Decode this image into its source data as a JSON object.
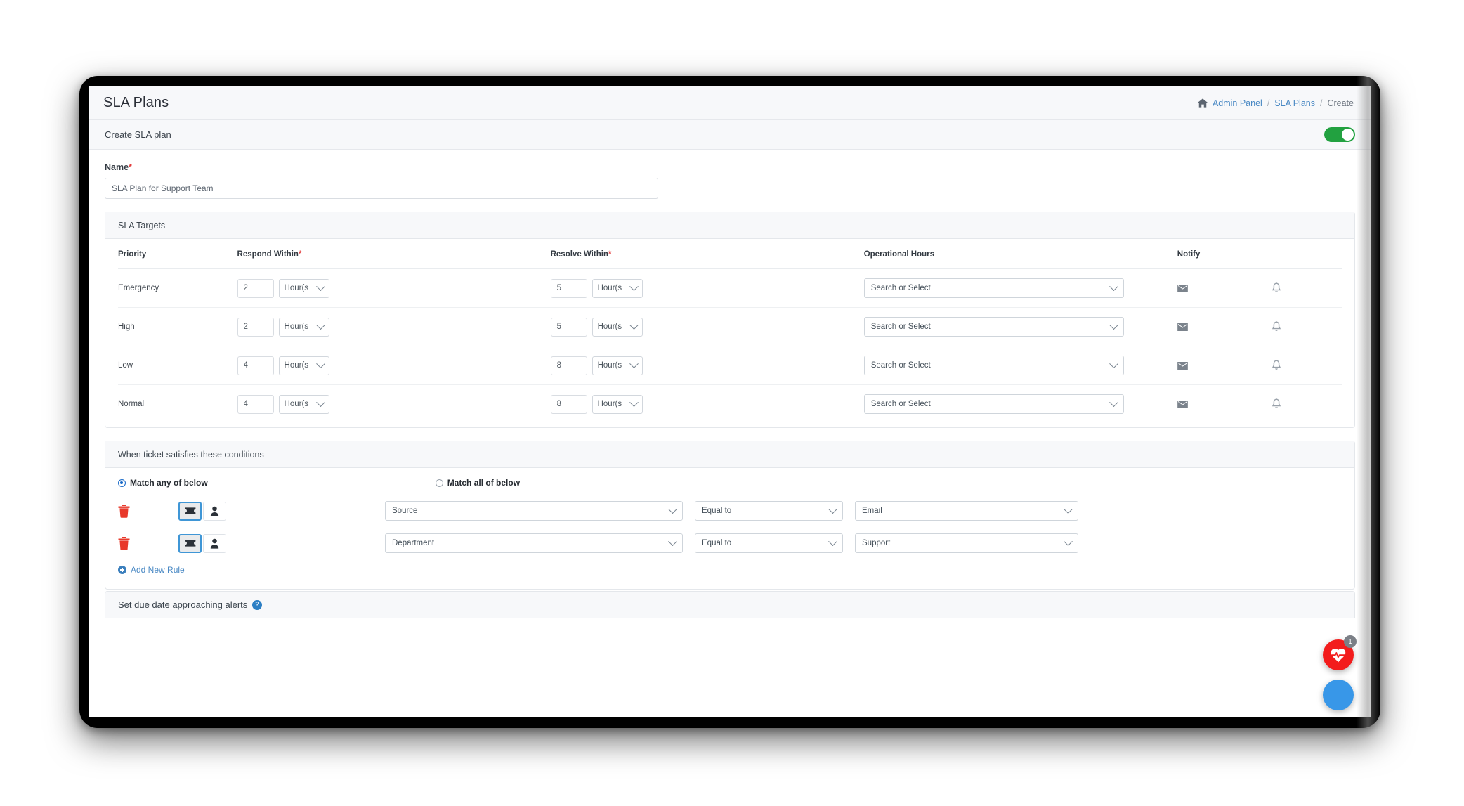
{
  "header": {
    "title": "SLA Plans",
    "breadcrumb": {
      "home_icon": "home-icon",
      "items": [
        "Admin Panel",
        "SLA Plans",
        "Create"
      ],
      "separator": "/"
    }
  },
  "create_bar": {
    "label": "Create SLA plan",
    "toggle_state": "on",
    "toggle_color": "#22a140"
  },
  "form": {
    "name_label": "Name",
    "required_marker": "*",
    "name_value": "SLA Plan for Support Team",
    "name_placeholder": "SLA Plan for Support Team"
  },
  "targets_panel": {
    "title": "SLA Targets",
    "columns": [
      "Priority",
      "Respond Within",
      "Resolve Within",
      "Operational Hours",
      "Notify"
    ],
    "respond_required": "*",
    "resolve_required": "*",
    "operational_hours_placeholder": "Search or Select",
    "rows": [
      {
        "priority": "Emergency",
        "respond_value": "2",
        "respond_unit": "Hour(s",
        "resolve_value": "5",
        "resolve_unit": "Hour(s",
        "operational_hours": "Search or Select",
        "notify_email_icon": "envelope-icon",
        "notify_bell_icon": "bell-icon"
      },
      {
        "priority": "High",
        "respond_value": "2",
        "respond_unit": "Hour(s",
        "resolve_value": "5",
        "resolve_unit": "Hour(s",
        "operational_hours": "Search or Select",
        "notify_email_icon": "envelope-icon",
        "notify_bell_icon": "bell-icon"
      },
      {
        "priority": "Low",
        "respond_value": "4",
        "respond_unit": "Hour(s",
        "resolve_value": "8",
        "resolve_unit": "Hour(s",
        "operational_hours": "Search or Select",
        "notify_email_icon": "envelope-icon",
        "notify_bell_icon": "bell-icon"
      },
      {
        "priority": "Normal",
        "respond_value": "4",
        "respond_unit": "Hour(s",
        "resolve_value": "8",
        "resolve_unit": "Hour(s",
        "operational_hours": "Search or Select",
        "notify_email_icon": "envelope-icon",
        "notify_bell_icon": "bell-icon"
      }
    ]
  },
  "conditions_panel": {
    "title": "When ticket satisfies these conditions",
    "match_any_label": "Match any of below",
    "match_all_label": "Match all of below",
    "selected_match": "any",
    "rules": [
      {
        "delete_icon": "trash-icon",
        "type_ticket_icon": "ticket-icon",
        "type_user_icon": "user-icon",
        "selected_type": "ticket",
        "field": "Source",
        "operator": "Equal to",
        "value": "Email"
      },
      {
        "delete_icon": "trash-icon",
        "type_ticket_icon": "ticket-icon",
        "type_user_icon": "user-icon",
        "selected_type": "ticket",
        "field": "Department",
        "operator": "Equal to",
        "value": "Support"
      }
    ],
    "add_rule_label": "Add New Rule"
  },
  "alerts_panel": {
    "title": "Set due date approaching alerts",
    "help_icon": "help-icon",
    "help_glyph": "?"
  },
  "floating_buttons": {
    "health": {
      "icon": "heartbeat-icon",
      "badge": "1",
      "color": "#f31c1c"
    },
    "chat": {
      "icon": "chat-icon",
      "color": "#3897e8"
    }
  }
}
